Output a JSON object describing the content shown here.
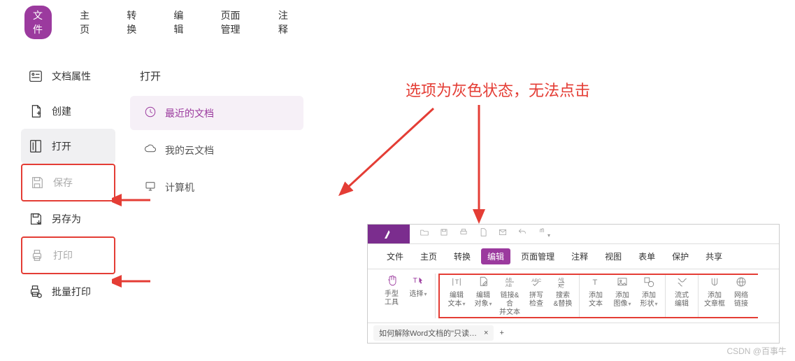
{
  "main_tabs": [
    "文件",
    "主页",
    "转换",
    "编辑",
    "页面管理",
    "注释"
  ],
  "main_tab_active": 0,
  "file_menu": {
    "items": [
      {
        "label": "文档属性",
        "icon": "props"
      },
      {
        "label": "创建",
        "icon": "create"
      },
      {
        "label": "打开",
        "icon": "open",
        "selected": true
      },
      {
        "label": "保存",
        "icon": "save",
        "disabled": true,
        "boxed": true
      },
      {
        "label": "另存为",
        "icon": "saveas"
      },
      {
        "label": "打印",
        "icon": "print",
        "disabled": true,
        "boxed": true
      },
      {
        "label": "批量打印",
        "icon": "batchprint"
      }
    ]
  },
  "sub_header": "打开",
  "sub_items": [
    {
      "label": "最近的文档",
      "icon": "clock",
      "active": true
    },
    {
      "label": "我的云文档",
      "icon": "cloud"
    },
    {
      "label": "计算机",
      "icon": "computer"
    }
  ],
  "annotation": "选项为灰色状态，无法点击",
  "ribbon": {
    "tabs": [
      "文件",
      "主页",
      "转换",
      "编辑",
      "页面管理",
      "注释",
      "视图",
      "表单",
      "保护",
      "共享"
    ],
    "active": 3,
    "tools": [
      {
        "group": 0,
        "label": "手型\n工具",
        "icon": "hand",
        "highlight": true
      },
      {
        "group": 0,
        "label": "选择",
        "icon": "select",
        "highlight": true,
        "drop": true
      },
      {
        "group": 1,
        "label": "编辑\n文本",
        "icon": "edittext",
        "drop": true
      },
      {
        "group": 1,
        "label": "编辑\n对象",
        "icon": "editobj",
        "drop": true
      },
      {
        "group": 1,
        "label": "链接&合\n并文本",
        "icon": "linkmerge"
      },
      {
        "group": 1,
        "label": "拼写\n检查",
        "icon": "spell"
      },
      {
        "group": 1,
        "label": "搜索\n&替换",
        "icon": "findreplace"
      },
      {
        "group": 2,
        "label": "添加\n文本",
        "icon": "addtext"
      },
      {
        "group": 2,
        "label": "添加\n图像",
        "icon": "addimg",
        "drop": true
      },
      {
        "group": 2,
        "label": "添加\n形状",
        "icon": "addshape",
        "drop": true
      },
      {
        "group": 3,
        "label": "流式\n编辑",
        "icon": "flowedit"
      },
      {
        "group": 4,
        "label": "添加\n文章框",
        "icon": "article"
      },
      {
        "group": 4,
        "label": "网络\n链接",
        "icon": "weblink"
      }
    ]
  },
  "doc_tab": "如何解除Word文档的\"只读…",
  "watermark": "CSDN @百事牛"
}
